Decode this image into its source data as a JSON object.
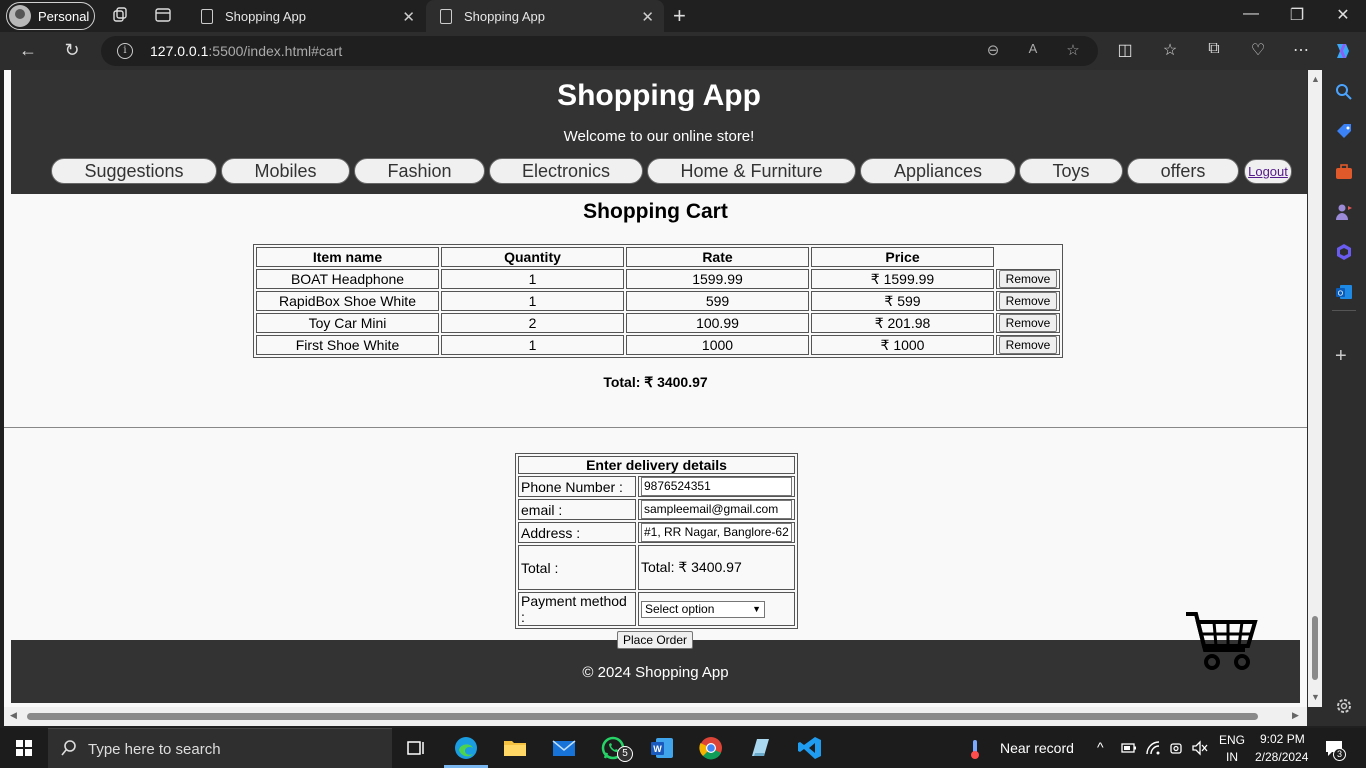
{
  "browser": {
    "profile_label": "Personal",
    "tabs": [
      {
        "title": "Shopping App"
      },
      {
        "title": "Shopping App"
      }
    ],
    "url_host": "127.0.0.1",
    "url_rest": ":5500/index.html#cart"
  },
  "site": {
    "title": "Shopping App",
    "welcome": "Welcome to our online store!",
    "nav": [
      "Suggestions",
      "Mobiles",
      "Fashion",
      "Electronics",
      "Home & Furniture",
      "Appliances",
      "Toys",
      "offers"
    ],
    "logout": "Logout"
  },
  "cart": {
    "title": "Shopping Cart",
    "headers": [
      "Item name",
      "Quantity",
      "Rate",
      "Price"
    ],
    "rows": [
      {
        "name": "BOAT Headphone",
        "qty": "1",
        "rate": "1599.99",
        "price": "₹ 1599.99",
        "action": "Remove"
      },
      {
        "name": "RapidBox Shoe White",
        "qty": "1",
        "rate": "599",
        "price": "₹ 599",
        "action": "Remove"
      },
      {
        "name": "Toy Car Mini",
        "qty": "2",
        "rate": "100.99",
        "price": "₹ 201.98",
        "action": "Remove"
      },
      {
        "name": "First Shoe White",
        "qty": "1",
        "rate": "1000",
        "price": "₹ 1000",
        "action": "Remove"
      }
    ],
    "total": "Total: ₹ 3400.97"
  },
  "delivery": {
    "title": "Enter delivery details",
    "phone_label": "Phone Number :",
    "phone_value": "9876524351",
    "email_label": "email :",
    "email_value": "sampleemail@gmail.com",
    "address_label": "Address :",
    "address_value": "#1, RR Nagar, Banglore-62",
    "total_label": "Total :",
    "total_value": "Total: ₹ 3400.97",
    "payment_label": "Payment method :",
    "payment_value": "Select option",
    "place_order": "Place Order"
  },
  "footer": {
    "text": "© 2024 Shopping App"
  },
  "taskbar": {
    "search_placeholder": "Type here to search",
    "whatsapp_badge": "5",
    "weather": "Near record",
    "lang": "ENG",
    "region": "IN",
    "time": "9:02 PM",
    "date": "2/28/2024",
    "notif_count": "3"
  }
}
